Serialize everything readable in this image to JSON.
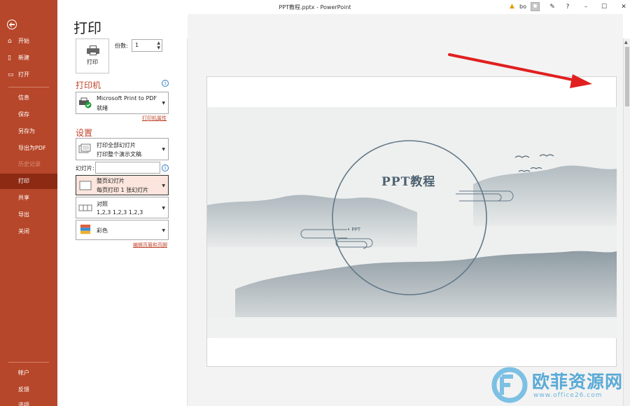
{
  "window": {
    "title": "PPT教程.pptx  -  PowerPoint",
    "user": "bo",
    "help": "?"
  },
  "nav": {
    "items": [
      {
        "label": "开始",
        "icon": "home-icon"
      },
      {
        "label": "新建",
        "icon": "new-file-icon"
      },
      {
        "label": "打开",
        "icon": "open-folder-icon"
      },
      {
        "label": "信息"
      },
      {
        "label": "保存"
      },
      {
        "label": "另存为"
      },
      {
        "label": "导出为PDF"
      },
      {
        "label": "历史记录",
        "disabled": true
      },
      {
        "label": "打印",
        "active": true
      },
      {
        "label": "共享"
      },
      {
        "label": "导出"
      },
      {
        "label": "关闭"
      }
    ],
    "bottom": [
      {
        "label": "帐户"
      },
      {
        "label": "反馈"
      },
      {
        "label": "选项"
      }
    ]
  },
  "print": {
    "heading": "打印",
    "button_label": "打印",
    "copies_label": "份数:",
    "copies_value": "1",
    "printer_heading": "打印机",
    "printer_name": "Microsoft Print to PDF",
    "printer_status": "就绪",
    "printer_props_link": "打印机属性",
    "settings_heading": "设置",
    "range_line1": "打印全部幻灯片",
    "range_line2": "打印整个演示文稿",
    "slides_label": "幻灯片:",
    "slides_value": "",
    "layout_line1": "整页幻灯片",
    "layout_line2": "每页打印 1 张幻灯片",
    "collate_line1": "对照",
    "collate_line2": "1,2,3    1,2,3    1,2,3",
    "color_label": "彩色",
    "header_footer_link": "编辑页眉和页脚"
  },
  "slide": {
    "title": "PPT教程",
    "subtitle": "• PPT"
  },
  "watermark": {
    "name": "欧菲资源网",
    "url": "www.office26.com"
  },
  "colors": {
    "nav_bg": "#b7472a",
    "nav_active": "#8c2a14",
    "accent": "#c0442a",
    "annotation_arrow": "#e02020"
  }
}
